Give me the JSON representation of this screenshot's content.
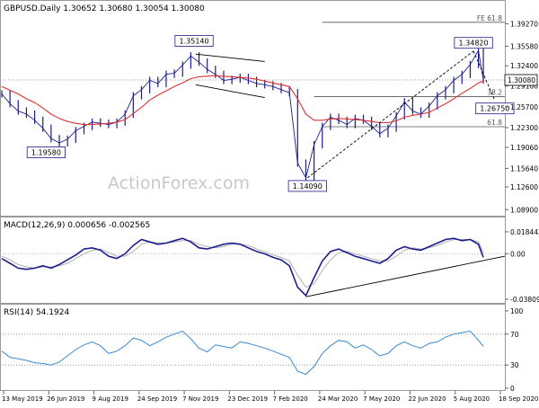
{
  "chart_data": [
    {
      "type": "line",
      "panel": "price",
      "header": "GBPUSD.Daily   1.30652  1.30680  1.30054  1.30080",
      "watermark": "ActionForex.com",
      "last_price": "1.30080",
      "y_ticks": [
        "1.39270",
        "1.35580",
        "1.32400",
        "1.29100",
        "1.25700",
        "1.22300",
        "1.19060",
        "1.15640",
        "1.12600",
        "1.08900"
      ],
      "ylim": [
        1.085,
        1.405
      ],
      "x": [
        0,
        5,
        10,
        15,
        20,
        25,
        30,
        35,
        40,
        45,
        50,
        55,
        60,
        65,
        70,
        75,
        80,
        85,
        90,
        95,
        100,
        105,
        110,
        115,
        120,
        125,
        130,
        135,
        140,
        145,
        150,
        155,
        160,
        165,
        170,
        175,
        180,
        185,
        190,
        195,
        200,
        205,
        210,
        215,
        220,
        225,
        230,
        235,
        240,
        245,
        250,
        255,
        260,
        265,
        270,
        275,
        280,
        285,
        290,
        293
      ],
      "series": [
        {
          "values": [
            1.278,
            1.262,
            1.25,
            1.245,
            1.235,
            1.222,
            1.205,
            1.198,
            1.204,
            1.218,
            1.225,
            1.232,
            1.23,
            1.228,
            1.232,
            1.245,
            1.275,
            1.285,
            1.3,
            1.295,
            1.31,
            1.312,
            1.325,
            1.34,
            1.33,
            1.318,
            1.31,
            1.3,
            1.302,
            1.305,
            1.3,
            1.295,
            1.293,
            1.29,
            1.285,
            1.28,
            1.165,
            1.141,
            1.195,
            1.225,
            1.24,
            1.235,
            1.228,
            1.238,
            1.235,
            1.225,
            1.213,
            1.222,
            1.242,
            1.265,
            1.25,
            1.245,
            1.258,
            1.275,
            1.285,
            1.3,
            1.31,
            1.326,
            1.349,
            1.301
          ]
        },
        {
          "values": [
            1.29,
            1.284,
            1.278,
            1.27,
            1.264,
            1.255,
            1.245,
            1.238,
            1.233,
            1.23,
            1.228,
            1.228,
            1.229,
            1.23,
            1.232,
            1.236,
            1.246,
            1.256,
            1.268,
            1.276,
            1.283,
            1.29,
            1.296,
            1.303,
            1.306,
            1.307,
            1.308,
            1.307,
            1.306,
            1.305,
            1.304,
            1.302,
            1.299,
            1.296,
            1.293,
            1.29,
            1.27,
            1.245,
            1.235,
            1.235,
            1.237,
            1.238,
            1.237,
            1.236,
            1.235,
            1.233,
            1.231,
            1.231,
            1.234,
            1.24,
            1.243,
            1.245,
            1.248,
            1.255,
            1.262,
            1.27,
            1.279,
            1.287,
            1.296,
            1.299
          ]
        }
      ],
      "annotations": [
        {
          "text": "1.19580",
          "x": 27,
          "y": 1.1958
        },
        {
          "text": "1.35140",
          "x": 117,
          "y": 1.3514
        },
        {
          "text": "1.14090",
          "x": 186,
          "y": 1.1409
        },
        {
          "text": "1.34820",
          "x": 287,
          "y": 1.3482
        },
        {
          "text": "1.26750",
          "x": 300,
          "y": 1.2675
        }
      ],
      "fib_levels": [
        {
          "label": "FE 61.8",
          "value": 1.395
        },
        {
          "label": "38.2",
          "value": 1.2735
        },
        {
          "label": "61.8",
          "value": 1.2245
        }
      ]
    },
    {
      "type": "line",
      "panel": "macd",
      "header": "MACD(12,26,9) 0.000656 -0.002565",
      "y_ticks": [
        "0.018442",
        "0.00",
        "-0.038095"
      ],
      "ylim": [
        -0.0381,
        0.0184
      ],
      "x": [
        0,
        5,
        10,
        15,
        20,
        25,
        30,
        35,
        40,
        45,
        50,
        55,
        60,
        65,
        70,
        75,
        80,
        85,
        90,
        95,
        100,
        105,
        110,
        115,
        120,
        125,
        130,
        135,
        140,
        145,
        150,
        155,
        160,
        165,
        170,
        175,
        180,
        185,
        190,
        195,
        200,
        205,
        210,
        215,
        220,
        225,
        230,
        235,
        240,
        245,
        250,
        255,
        260,
        265,
        270,
        275,
        280,
        285,
        290,
        293
      ],
      "series": [
        {
          "values": [
            -0.004,
            -0.008,
            -0.012,
            -0.013,
            -0.012,
            -0.01,
            -0.012,
            -0.009,
            -0.005,
            -0.001,
            0.004,
            0.005,
            0.003,
            -0.002,
            -0.004,
            0.0,
            0.007,
            0.012,
            0.01,
            0.008,
            0.009,
            0.011,
            0.013,
            0.01,
            0.005,
            0.004,
            0.006,
            0.008,
            0.009,
            0.008,
            0.005,
            0.002,
            0.0,
            -0.003,
            -0.005,
            -0.01,
            -0.028,
            -0.035,
            -0.02,
            -0.006,
            0.002,
            0.004,
            0.001,
            -0.002,
            -0.004,
            -0.006,
            -0.008,
            -0.004,
            0.003,
            0.006,
            0.004,
            0.003,
            0.006,
            0.009,
            0.012,
            0.013,
            0.011,
            0.012,
            0.008,
            -0.003
          ]
        },
        {
          "values": [
            -0.002,
            -0.005,
            -0.009,
            -0.011,
            -0.012,
            -0.011,
            -0.011,
            -0.01,
            -0.008,
            -0.004,
            0.0,
            0.003,
            0.004,
            0.001,
            -0.002,
            -0.002,
            0.002,
            0.008,
            0.01,
            0.009,
            0.009,
            0.01,
            0.011,
            0.011,
            0.008,
            0.006,
            0.005,
            0.006,
            0.008,
            0.008,
            0.007,
            0.004,
            0.002,
            -0.001,
            -0.003,
            -0.006,
            -0.018,
            -0.028,
            -0.025,
            -0.014,
            -0.005,
            0.001,
            0.002,
            0.0,
            -0.002,
            -0.004,
            -0.006,
            -0.006,
            -0.002,
            0.003,
            0.005,
            0.004,
            0.005,
            0.007,
            0.01,
            0.012,
            0.012,
            0.012,
            0.01,
            0.001
          ]
        }
      ]
    },
    {
      "type": "line",
      "panel": "rsi",
      "header": "RSI(14) 54.1924",
      "y_ticks": [
        "100",
        "70",
        "30",
        "0"
      ],
      "ylim": [
        0,
        100
      ],
      "x_ticks": [
        "13 May 2019",
        "26 Jun 2019",
        "9 Aug 2019",
        "24 Sep 2019",
        "7 Nov 2019",
        "23 Dec 2019",
        "7 Feb 2020",
        "24 Mar 2020",
        "7 May 2020",
        "22 Jun 2020",
        "5 Aug 2020",
        "18 Sep 2020"
      ],
      "x": [
        0,
        5,
        10,
        15,
        20,
        25,
        30,
        35,
        40,
        45,
        50,
        55,
        60,
        65,
        70,
        75,
        80,
        85,
        90,
        95,
        100,
        105,
        110,
        115,
        120,
        125,
        130,
        135,
        140,
        145,
        150,
        155,
        160,
        165,
        170,
        175,
        180,
        185,
        190,
        195,
        200,
        205,
        210,
        215,
        220,
        225,
        230,
        235,
        240,
        245,
        250,
        255,
        260,
        265,
        270,
        275,
        280,
        285,
        290,
        293
      ],
      "series": [
        {
          "values": [
            48,
            40,
            38,
            36,
            33,
            32,
            30,
            34,
            42,
            50,
            56,
            60,
            55,
            45,
            48,
            55,
            65,
            62,
            55,
            60,
            66,
            70,
            74,
            64,
            52,
            47,
            56,
            54,
            52,
            60,
            58,
            55,
            52,
            48,
            44,
            40,
            22,
            18,
            28,
            45,
            55,
            62,
            60,
            52,
            56,
            50,
            42,
            45,
            55,
            60,
            55,
            52,
            58,
            60,
            66,
            70,
            72,
            74,
            62,
            54
          ]
        }
      ]
    }
  ]
}
